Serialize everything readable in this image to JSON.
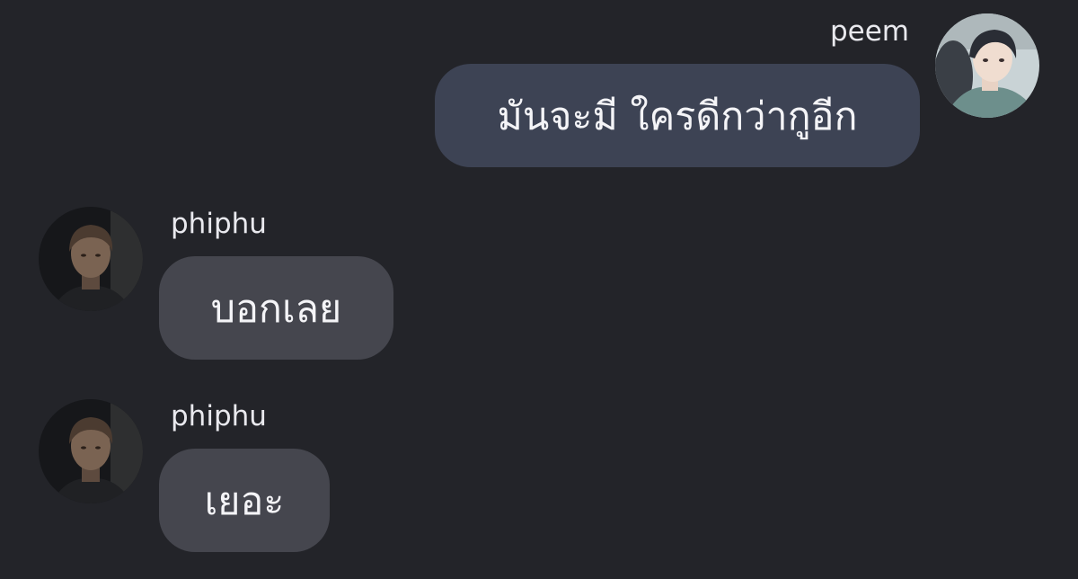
{
  "messages": [
    {
      "sender": "peem",
      "direction": "outgoing",
      "text": "มันจะมี ใครดีกว่ากูอีก",
      "avatar_icon": "user-avatar-peem-icon"
    },
    {
      "sender": "phiphu",
      "direction": "incoming",
      "text": "บอกเลย",
      "avatar_icon": "user-avatar-phiphu-icon"
    },
    {
      "sender": "phiphu",
      "direction": "incoming",
      "text": "เยอะ",
      "avatar_icon": "user-avatar-phiphu-icon"
    }
  ],
  "colors": {
    "background": "#232429",
    "outgoing_bubble": "#3d4354",
    "incoming_bubble": "#45464e",
    "text": "#f4f4f7"
  }
}
